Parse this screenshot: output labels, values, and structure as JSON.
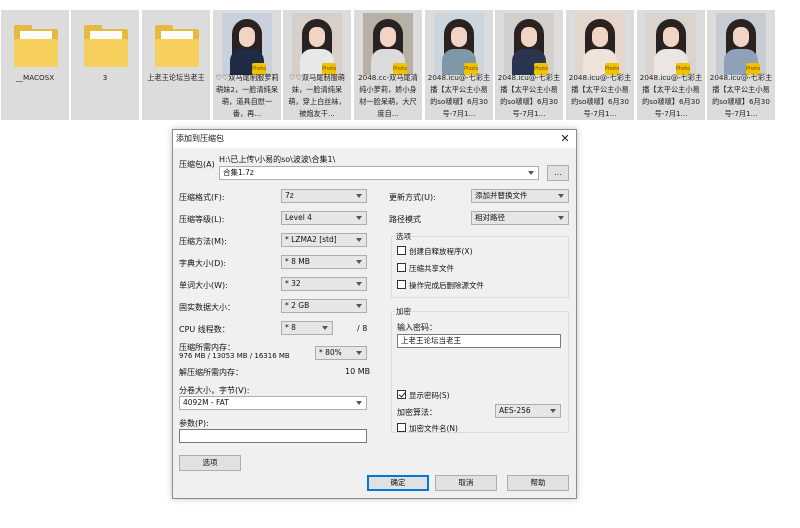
{
  "files": [
    {
      "kind": "folder",
      "name": "__MACOSX"
    },
    {
      "kind": "folder",
      "name": "3"
    },
    {
      "kind": "folder",
      "name": "上老王论坛当老王"
    },
    {
      "kind": "image",
      "name": "♡♡双马尾制服萝莉萌妹2，一脸清纯呆萌，道具自慰一番，再...",
      "badge": "Photo",
      "tint": "#c9d2dc",
      "outfit": "#1f2b45"
    },
    {
      "kind": "image",
      "name": "♡♡双马尾制服萌妹，一脸清纯呆萌，穿上白丝袜，被炮友干...",
      "badge": "Photo",
      "tint": "#d6cfca",
      "outfit": "#e8e8e8"
    },
    {
      "kind": "image",
      "name": "2048.cc-双马尾清纯小萝莉，娇小身材一脸呆萌，大尺度自...",
      "badge": "Photo",
      "tint": "#b7b0a7",
      "outfit": "#dcdcdc"
    },
    {
      "kind": "image",
      "name": "2048.icu@-七彩主播【太平公主小易的so啵啵】6月30号-7月1...",
      "badge": "Photo",
      "tint": "#cdd6dc",
      "outfit": "#7f98a8"
    },
    {
      "kind": "image",
      "name": "2048.icu@-七彩主播【太平公主小易的so啵啵】6月30号-7月1...",
      "badge": "Photo",
      "tint": "#d3cfcc",
      "outfit": "#2a3550"
    },
    {
      "kind": "image",
      "name": "2048.icu@-七彩主播【太平公主小易的so啵啵】6月30号-7月1...",
      "badge": "Photo",
      "tint": "#e4d6cc",
      "outfit": "#f0e4da"
    },
    {
      "kind": "image",
      "name": "2048.icu@-七彩主播【太平公主小易的so啵啵】6月30号-7月1...",
      "badge": "Photo",
      "tint": "#d9d4d0",
      "outfit": "#ece6e2"
    },
    {
      "kind": "image",
      "name": "2048.icu@-七彩主播【太平公主小易的so啵啵】6月30号-7月1...",
      "badge": "Photo",
      "tint": "#c7ccd2",
      "outfit": "#8fa0b8"
    }
  ],
  "dialog": {
    "title": "添加到压缩包",
    "close_glyph": "✕",
    "archive_label": "压缩包(A)",
    "archive_path": "H:\\已上传\\小易的so\\波波\\合集1\\",
    "archive_name": "合集1.7z",
    "browse_label": "...",
    "format_label": "压缩格式(F):",
    "format_value": "7z",
    "level_label": "压缩等级(L):",
    "level_value": "Level 4",
    "method_label": "压缩方法(M):",
    "method_value": "* LZMA2 [std]",
    "dict_label": "字典大小(D):",
    "dict_value": "* 8 MB",
    "word_label": "单词大小(W):",
    "word_value": "* 32",
    "solid_label": "固实数据大小：",
    "solid_value": "* 2 GB",
    "cpu_label": "CPU 线程数：",
    "cpu_value": "* 8",
    "cpu_max": "/ 8",
    "mem_comp_label": "压缩所需内存：",
    "mem_comp_detail": "976 MB / 13053 MB / 16316 MB",
    "mem_comp_value": "* 80%",
    "mem_decomp_label": "解压缩所需内存：",
    "mem_decomp_value": "10 MB",
    "split_label": "分卷大小，字节(V):",
    "split_value": "4092M - FAT",
    "params_label": "参数(P):",
    "params_value": "",
    "options_button": "选项",
    "update_label": "更新方式(U):",
    "update_value": "添加并替换文件",
    "path_label": "路径模式",
    "path_value": "相对路径",
    "options_group": "选项",
    "opt_sfx": "创建自释放程序(X)",
    "opt_shared": "压缩共享文件",
    "opt_delete": "操作完成后删除源文件",
    "encrypt_group": "加密",
    "password_label": "输入密码：",
    "password_value": "上老王论坛当老王",
    "show_password": "显示密码(S)",
    "encrypt_method_label": "加密算法：",
    "encrypt_method_value": "AES-256",
    "encrypt_names": "加密文件名(N)",
    "ok_button": "确定",
    "cancel_button": "取消",
    "help_button": "帮助"
  }
}
